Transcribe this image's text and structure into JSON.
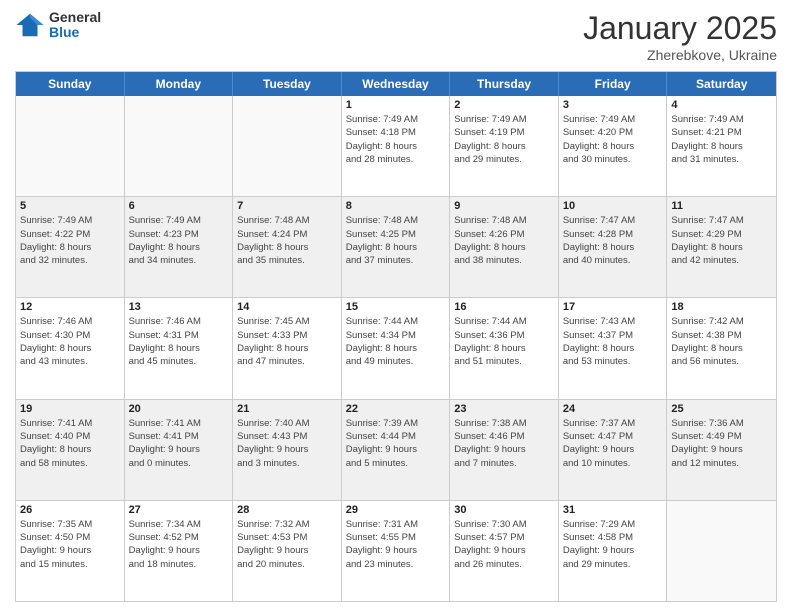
{
  "header": {
    "logo_general": "General",
    "logo_blue": "Blue",
    "month_title": "January 2025",
    "subtitle": "Zherebkove, Ukraine"
  },
  "weekdays": [
    "Sunday",
    "Monday",
    "Tuesday",
    "Wednesday",
    "Thursday",
    "Friday",
    "Saturday"
  ],
  "weeks": [
    [
      {
        "day": "",
        "info": ""
      },
      {
        "day": "",
        "info": ""
      },
      {
        "day": "",
        "info": ""
      },
      {
        "day": "1",
        "info": "Sunrise: 7:49 AM\nSunset: 4:18 PM\nDaylight: 8 hours\nand 28 minutes."
      },
      {
        "day": "2",
        "info": "Sunrise: 7:49 AM\nSunset: 4:19 PM\nDaylight: 8 hours\nand 29 minutes."
      },
      {
        "day": "3",
        "info": "Sunrise: 7:49 AM\nSunset: 4:20 PM\nDaylight: 8 hours\nand 30 minutes."
      },
      {
        "day": "4",
        "info": "Sunrise: 7:49 AM\nSunset: 4:21 PM\nDaylight: 8 hours\nand 31 minutes."
      }
    ],
    [
      {
        "day": "5",
        "info": "Sunrise: 7:49 AM\nSunset: 4:22 PM\nDaylight: 8 hours\nand 32 minutes."
      },
      {
        "day": "6",
        "info": "Sunrise: 7:49 AM\nSunset: 4:23 PM\nDaylight: 8 hours\nand 34 minutes."
      },
      {
        "day": "7",
        "info": "Sunrise: 7:48 AM\nSunset: 4:24 PM\nDaylight: 8 hours\nand 35 minutes."
      },
      {
        "day": "8",
        "info": "Sunrise: 7:48 AM\nSunset: 4:25 PM\nDaylight: 8 hours\nand 37 minutes."
      },
      {
        "day": "9",
        "info": "Sunrise: 7:48 AM\nSunset: 4:26 PM\nDaylight: 8 hours\nand 38 minutes."
      },
      {
        "day": "10",
        "info": "Sunrise: 7:47 AM\nSunset: 4:28 PM\nDaylight: 8 hours\nand 40 minutes."
      },
      {
        "day": "11",
        "info": "Sunrise: 7:47 AM\nSunset: 4:29 PM\nDaylight: 8 hours\nand 42 minutes."
      }
    ],
    [
      {
        "day": "12",
        "info": "Sunrise: 7:46 AM\nSunset: 4:30 PM\nDaylight: 8 hours\nand 43 minutes."
      },
      {
        "day": "13",
        "info": "Sunrise: 7:46 AM\nSunset: 4:31 PM\nDaylight: 8 hours\nand 45 minutes."
      },
      {
        "day": "14",
        "info": "Sunrise: 7:45 AM\nSunset: 4:33 PM\nDaylight: 8 hours\nand 47 minutes."
      },
      {
        "day": "15",
        "info": "Sunrise: 7:44 AM\nSunset: 4:34 PM\nDaylight: 8 hours\nand 49 minutes."
      },
      {
        "day": "16",
        "info": "Sunrise: 7:44 AM\nSunset: 4:36 PM\nDaylight: 8 hours\nand 51 minutes."
      },
      {
        "day": "17",
        "info": "Sunrise: 7:43 AM\nSunset: 4:37 PM\nDaylight: 8 hours\nand 53 minutes."
      },
      {
        "day": "18",
        "info": "Sunrise: 7:42 AM\nSunset: 4:38 PM\nDaylight: 8 hours\nand 56 minutes."
      }
    ],
    [
      {
        "day": "19",
        "info": "Sunrise: 7:41 AM\nSunset: 4:40 PM\nDaylight: 8 hours\nand 58 minutes."
      },
      {
        "day": "20",
        "info": "Sunrise: 7:41 AM\nSunset: 4:41 PM\nDaylight: 9 hours\nand 0 minutes."
      },
      {
        "day": "21",
        "info": "Sunrise: 7:40 AM\nSunset: 4:43 PM\nDaylight: 9 hours\nand 3 minutes."
      },
      {
        "day": "22",
        "info": "Sunrise: 7:39 AM\nSunset: 4:44 PM\nDaylight: 9 hours\nand 5 minutes."
      },
      {
        "day": "23",
        "info": "Sunrise: 7:38 AM\nSunset: 4:46 PM\nDaylight: 9 hours\nand 7 minutes."
      },
      {
        "day": "24",
        "info": "Sunrise: 7:37 AM\nSunset: 4:47 PM\nDaylight: 9 hours\nand 10 minutes."
      },
      {
        "day": "25",
        "info": "Sunrise: 7:36 AM\nSunset: 4:49 PM\nDaylight: 9 hours\nand 12 minutes."
      }
    ],
    [
      {
        "day": "26",
        "info": "Sunrise: 7:35 AM\nSunset: 4:50 PM\nDaylight: 9 hours\nand 15 minutes."
      },
      {
        "day": "27",
        "info": "Sunrise: 7:34 AM\nSunset: 4:52 PM\nDaylight: 9 hours\nand 18 minutes."
      },
      {
        "day": "28",
        "info": "Sunrise: 7:32 AM\nSunset: 4:53 PM\nDaylight: 9 hours\nand 20 minutes."
      },
      {
        "day": "29",
        "info": "Sunrise: 7:31 AM\nSunset: 4:55 PM\nDaylight: 9 hours\nand 23 minutes."
      },
      {
        "day": "30",
        "info": "Sunrise: 7:30 AM\nSunset: 4:57 PM\nDaylight: 9 hours\nand 26 minutes."
      },
      {
        "day": "31",
        "info": "Sunrise: 7:29 AM\nSunset: 4:58 PM\nDaylight: 9 hours\nand 29 minutes."
      },
      {
        "day": "",
        "info": ""
      }
    ]
  ]
}
